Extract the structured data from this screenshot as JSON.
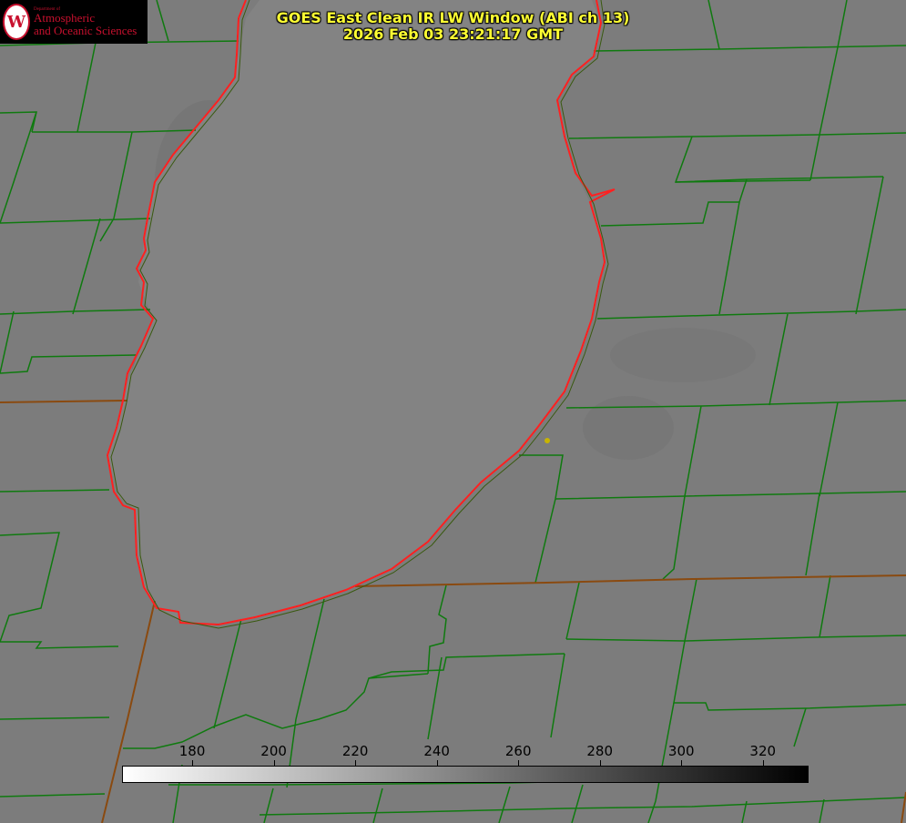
{
  "title": {
    "line1": "GOES East Clean IR LW Window (ABI ch 13)",
    "line2": "2026 Feb 03 23:21:17 GMT"
  },
  "logo": {
    "line1": "Department of",
    "line2": "Atmospheric",
    "line3": "and Oceanic Sciences",
    "seal_letter": "W"
  },
  "colorbar": {
    "ticks": [
      "180",
      "200",
      "220",
      "240",
      "260",
      "280",
      "300",
      "320"
    ],
    "tick_values": [
      180,
      200,
      220,
      240,
      260,
      280,
      300,
      320
    ],
    "range": [
      163,
      331
    ],
    "gradient": [
      "#ffffff",
      "#000000"
    ]
  },
  "colors": {
    "background": "#7c7c7c",
    "lake_fill": "#838383",
    "county_lines": "#0f7a0f",
    "state_lines": "#8a4a10",
    "coastline": "#ff2020",
    "title_text": "#ffff33",
    "marker": "#c8b400"
  }
}
